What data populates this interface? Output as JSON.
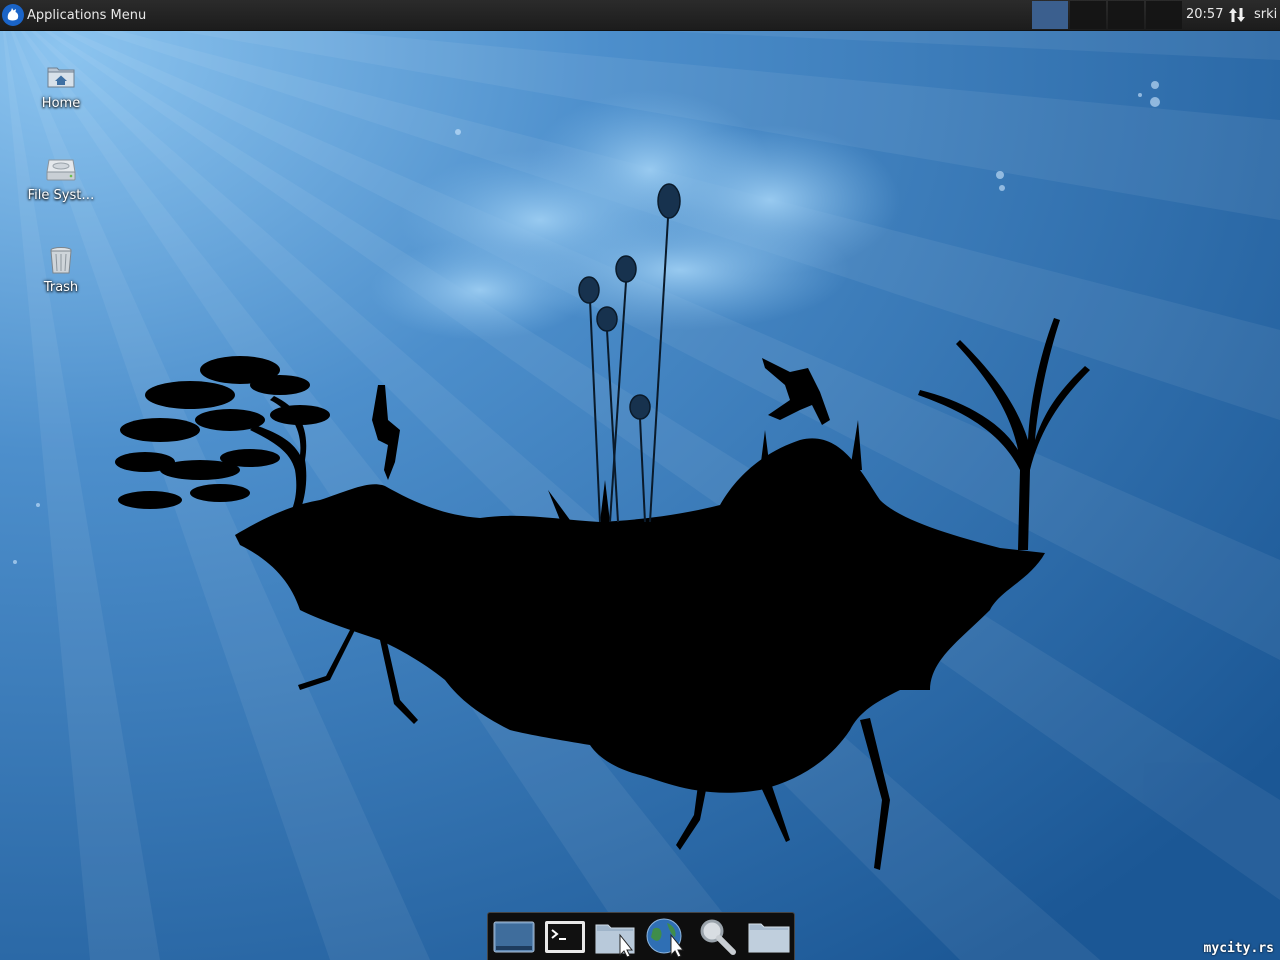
{
  "panel": {
    "menu_label": "Applications Menu",
    "workspaces": [
      "1",
      "2",
      "3",
      "4"
    ],
    "active_workspace": 0,
    "clock": "20:57",
    "user": "srki"
  },
  "desktop": {
    "icons": [
      {
        "label": "Home",
        "icon": "home-folder-icon"
      },
      {
        "label": "File Syst…",
        "icon": "hard-drive-icon"
      },
      {
        "label": "Trash",
        "icon": "trash-icon"
      }
    ]
  },
  "dock": {
    "items": [
      {
        "icon": "show-desktop-icon"
      },
      {
        "icon": "terminal-icon"
      },
      {
        "icon": "file-manager-icon"
      },
      {
        "icon": "web-browser-icon"
      },
      {
        "icon": "app-finder-icon"
      },
      {
        "icon": "folder-icon"
      }
    ]
  },
  "watermark": "mycity.rs",
  "colors": {
    "panel_bg": "#1f1f1f",
    "active_workspace": "#3b5f8e",
    "wallpaper_light": "#6fb0e6",
    "wallpaper_dark": "#1d5a96"
  }
}
